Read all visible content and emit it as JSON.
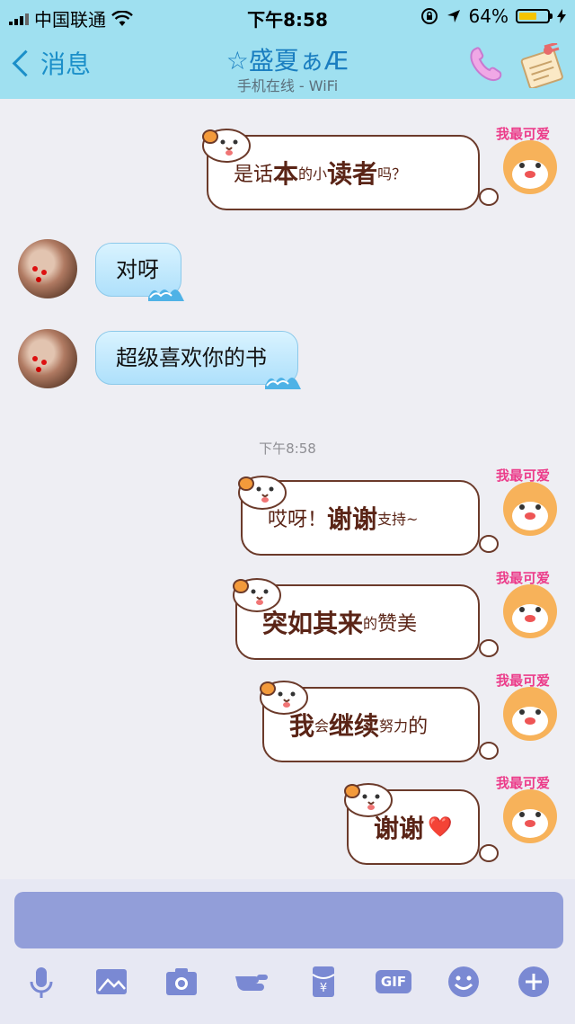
{
  "status_bar": {
    "carrier": "中国联通",
    "time": "下午8:58",
    "battery": "64%",
    "battery_level": 0.64
  },
  "nav": {
    "back_label": "消息",
    "title": "☆盛夏ぁÆ",
    "subtitle": "手机在线 - WiFi",
    "icons": [
      "phone-icon",
      "profile-card-icon"
    ]
  },
  "messages": [
    {
      "side": "sent",
      "parts": [
        {
          "text": "是话",
          "size": "mid"
        },
        {
          "text": "本",
          "size": "big"
        },
        {
          "text": "的",
          "size": "small"
        },
        {
          "text": "小",
          "size": "small"
        },
        {
          "text": "读者",
          "size": "big"
        },
        {
          "text": "吗？",
          "size": "small"
        }
      ]
    },
    {
      "side": "received",
      "text": "对呀"
    },
    {
      "side": "received",
      "text": "超级喜欢你的书"
    },
    {
      "side": "sent",
      "parts": [
        {
          "text": "哎呀！",
          "size": "mid"
        },
        {
          "text": "谢谢",
          "size": "big"
        },
        {
          "text": "支持~",
          "size": "small"
        }
      ]
    },
    {
      "side": "sent",
      "parts": [
        {
          "text": "突如其来",
          "size": "big"
        },
        {
          "text": "的",
          "size": "small"
        },
        {
          "text": "赞美",
          "size": "mid"
        }
      ]
    },
    {
      "side": "sent",
      "parts": [
        {
          "text": "我",
          "size": "big"
        },
        {
          "text": "会",
          "size": "small"
        },
        {
          "text": "继续",
          "size": "big"
        },
        {
          "text": "努力",
          "size": "small"
        },
        {
          "text": "的",
          "size": "mid"
        }
      ]
    },
    {
      "side": "sent",
      "parts": [
        {
          "text": "谢谢",
          "size": "big"
        }
      ],
      "emoji": "❤️"
    }
  ],
  "timestamp": "下午8:58",
  "sticker_avatar_text": "我最可爱",
  "toolbar": {
    "gif_label": "GIF",
    "icons": [
      "microphone-icon",
      "image-icon",
      "camera-icon",
      "poke-icon",
      "red-packet-icon",
      "gif-icon",
      "emoji-icon",
      "plus-icon"
    ]
  },
  "colors": {
    "header": "#9fe0f0",
    "accent": "#1b8fc9",
    "input": "#929ed9",
    "sent_text": "#5a2416"
  }
}
